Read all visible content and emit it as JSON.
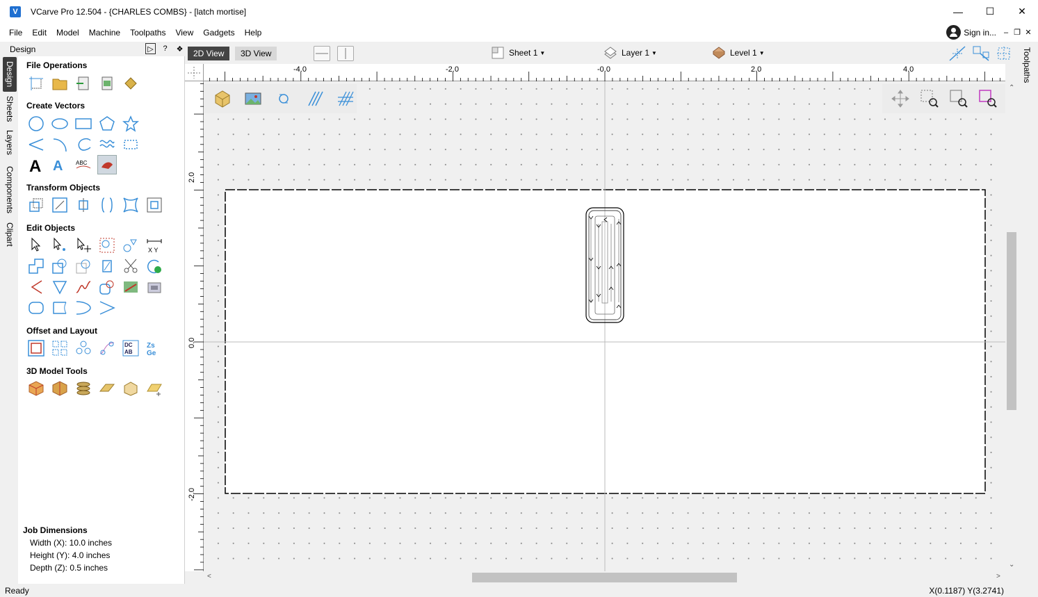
{
  "window": {
    "title": "VCarve Pro 12.504 - {CHARLES COMBS} - [latch mortise]",
    "app_icon": "vcarve-logo-icon"
  },
  "menu": [
    "File",
    "Edit",
    "Model",
    "Machine",
    "Toolpaths",
    "View",
    "Gadgets",
    "Help"
  ],
  "account": {
    "sign_in": "Sign in..."
  },
  "left_tabs": [
    "Design",
    "Sheets",
    "Layers",
    "Components",
    "Clipart"
  ],
  "panel": {
    "title": "Design",
    "sections": [
      {
        "title": "File Operations"
      },
      {
        "title": "Create Vectors"
      },
      {
        "title": "Transform Objects"
      },
      {
        "title": "Edit Objects"
      },
      {
        "title": "Offset and Layout"
      },
      {
        "title": "3D Model Tools"
      }
    ],
    "job": {
      "heading": "Job Dimensions",
      "width": "Width  (X): 10.0 inches",
      "height": "Height (Y): 4.0 inches",
      "depth": "Depth  (Z): 0.5 inches"
    }
  },
  "view": {
    "tab_2d": "2D View",
    "tab_3d": "3D View",
    "sheet": "Sheet 1",
    "layer": "Layer 1",
    "level": "Level 1",
    "right_tab": "Toolpaths"
  },
  "ruler": {
    "h_labels": [
      "-4.0",
      "-2.0",
      "-0.0",
      "2.0",
      "4.0"
    ],
    "v_labels": [
      "2.0",
      "0.0",
      "-2.0"
    ]
  },
  "status": {
    "left": "Ready",
    "coords": "X(0.1187) Y(3.2741)"
  },
  "colors": {
    "accent": "#1f6fd0",
    "icon_blue": "#3a8fd8",
    "tab_active": "#444444"
  }
}
